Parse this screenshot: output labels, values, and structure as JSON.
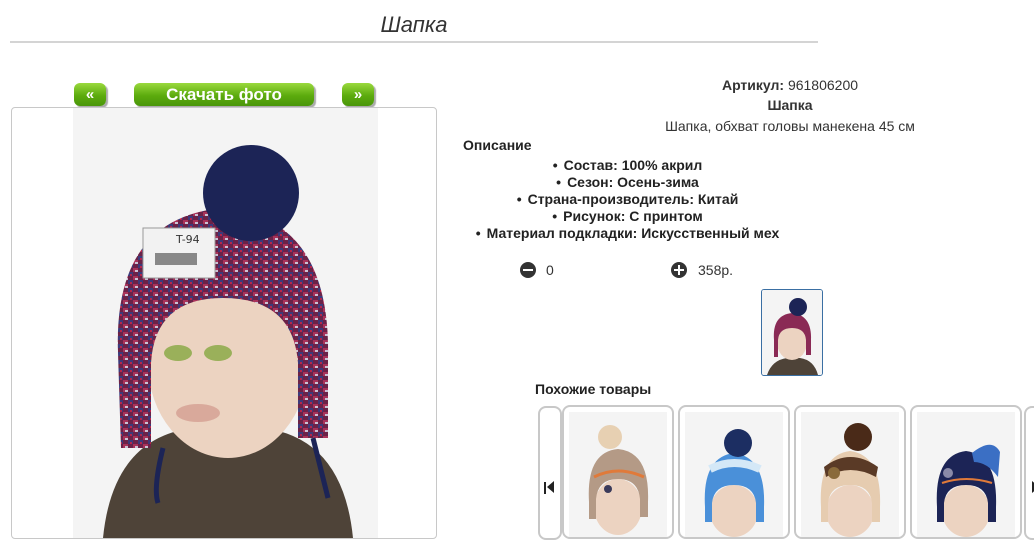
{
  "page": {
    "title": "Шапка"
  },
  "gallery": {
    "prev_label": "«",
    "download_label": "Скачать фото",
    "next_label": "»"
  },
  "product": {
    "article_label": "Артикул:",
    "article_value": "961806200",
    "name": "Шапка",
    "short_desc": "Шапка, обхват головы манекена 45 см"
  },
  "description": {
    "heading": "Описание",
    "specs": [
      "Состав: 100% акрил",
      "Сезон: Осень-зима",
      "Страна-производитель: Китай",
      "Рисунок: С принтом",
      "Материал подкладки: Искусственный мех"
    ]
  },
  "cart": {
    "quantity": "0",
    "price": "358р."
  },
  "similar": {
    "heading": "Похожие товары",
    "items": [
      {
        "icon": "beige-hat-photo"
      },
      {
        "icon": "blue-hat-photo"
      },
      {
        "icon": "brown-hat-photo"
      },
      {
        "icon": "navy-hat-photo"
      }
    ]
  },
  "colors": {
    "button_green": "#5cab0d",
    "thumb_border": "#3a6fa3"
  }
}
